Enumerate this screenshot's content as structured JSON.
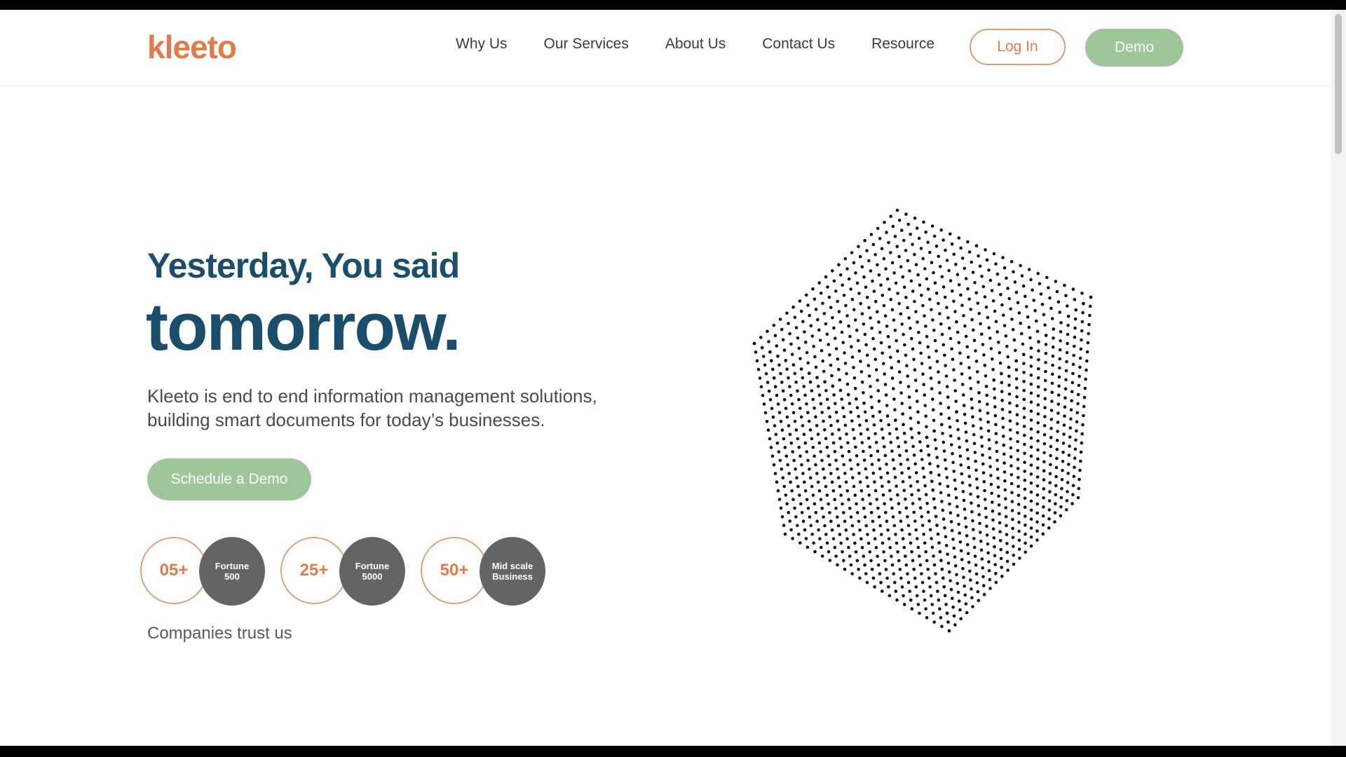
{
  "brand": {
    "logo_text": "kleeto",
    "colors": {
      "orange": "#e07c4c",
      "green": "#9fc59b",
      "navy": "#1b4e6b",
      "grey_circle": "#646464"
    }
  },
  "header": {
    "nav": [
      {
        "label": "Why Us"
      },
      {
        "label": "Our Services"
      },
      {
        "label": "About Us"
      },
      {
        "label": "Contact Us"
      },
      {
        "label": "Resource"
      }
    ],
    "login_label": "Log In",
    "demo_label": "Demo"
  },
  "hero": {
    "subtitle": "Yesterday, You said",
    "title": "tomorrow.",
    "description_line1": "Kleeto is end to end information management solutions,",
    "description_line2": "building smart documents for today’s businesses.",
    "cta_label": "Schedule a Demo"
  },
  "stats": [
    {
      "count": "05+",
      "label": "Fortune\n500"
    },
    {
      "count": "25+",
      "label": "Fortune\n5000"
    },
    {
      "count": "50+",
      "label": "Mid scale\nBusiness"
    }
  ],
  "trust_text": "Companies trust us",
  "graphic": {
    "icon": "dotted-cube-icon"
  }
}
